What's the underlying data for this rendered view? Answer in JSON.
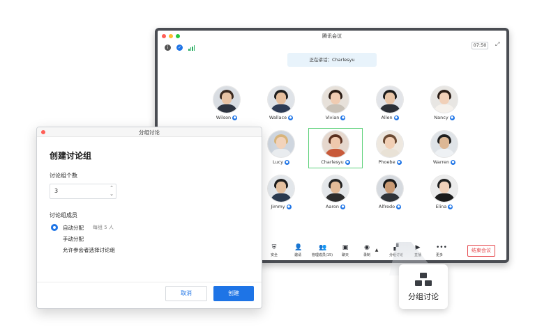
{
  "meeting": {
    "title": "腾讯会议",
    "time": "07:50",
    "speaking_banner": "正在讲话：Charlesyu",
    "participants": [
      {
        "name": "Wilson"
      },
      {
        "name": "Wallace"
      },
      {
        "name": "Vivian"
      },
      {
        "name": "Allen"
      },
      {
        "name": "Nancy"
      },
      {
        "name": "Lucy"
      },
      {
        "name": "Charlesyu",
        "active": true
      },
      {
        "name": "Phoebe"
      },
      {
        "name": "Warren"
      },
      {
        "name": "Jimmy"
      },
      {
        "name": "Aaron"
      },
      {
        "name": "Alfredo"
      },
      {
        "name": "Elina"
      }
    ],
    "toolbar": [
      {
        "label": "安全",
        "icon": "shield-icon"
      },
      {
        "label": "邀请",
        "icon": "invite-icon"
      },
      {
        "label": "管理成员(15)",
        "icon": "members-icon"
      },
      {
        "label": "聊天",
        "icon": "chat-icon"
      },
      {
        "label": "录制",
        "icon": "record-icon"
      },
      {
        "label": "分组讨论",
        "icon": "breakout-icon"
      },
      {
        "label": "直播",
        "icon": "live-icon"
      },
      {
        "label": "更多",
        "icon": "more-icon"
      }
    ],
    "end_button": "结束会议"
  },
  "dialog": {
    "title": "分组讨论",
    "heading": "创建讨论组",
    "count_label": "讨论组个数",
    "count_value": "3",
    "members_label": "讨论组成员",
    "option_auto": "自动分配",
    "option_auto_hint": "每组 5 人",
    "option_manual": "手动分配",
    "option_self": "允许参会者选择讨论组",
    "cancel": "取消",
    "create": "创建"
  },
  "callout": {
    "label": "分组讨论"
  },
  "colors": {
    "accent": "#1e74e6",
    "danger": "#e5484d",
    "active_border": "#5dd17a"
  }
}
